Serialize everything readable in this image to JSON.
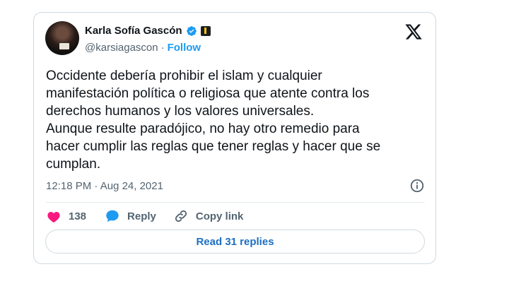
{
  "author": {
    "name": "Karla Sofía Gascón",
    "handle": "@karsiagascon",
    "separator": "·",
    "follow_label": "Follow"
  },
  "tweet": {
    "lines": [
      "Occidente debería prohibir el islam y cualquier",
      "manifestación política o religiosa que atente contra los",
      "derechos humanos y los valores universales.",
      "Aunque resulte paradójico, no hay otro remedio para",
      "hacer cumplir las reglas que tener reglas y hacer que se",
      "cumplan."
    ],
    "timestamp": "12:18 PM · Aug 24, 2021"
  },
  "actions": {
    "like_count": "138",
    "reply_label": "Reply",
    "copy_link_label": "Copy link"
  },
  "read_replies_label": "Read 31 replies",
  "icons": {
    "verified": "verified-badge-icon",
    "affiliate": "affiliate-badge-icon",
    "x_logo": "x-logo-icon",
    "info": "info-icon",
    "heart": "heart-icon",
    "reply": "reply-bubble-icon",
    "link": "link-icon"
  },
  "colors": {
    "accent": "#1d9bf0",
    "heart": "#f91880",
    "muted": "#536471",
    "border": "#cfd9de"
  }
}
